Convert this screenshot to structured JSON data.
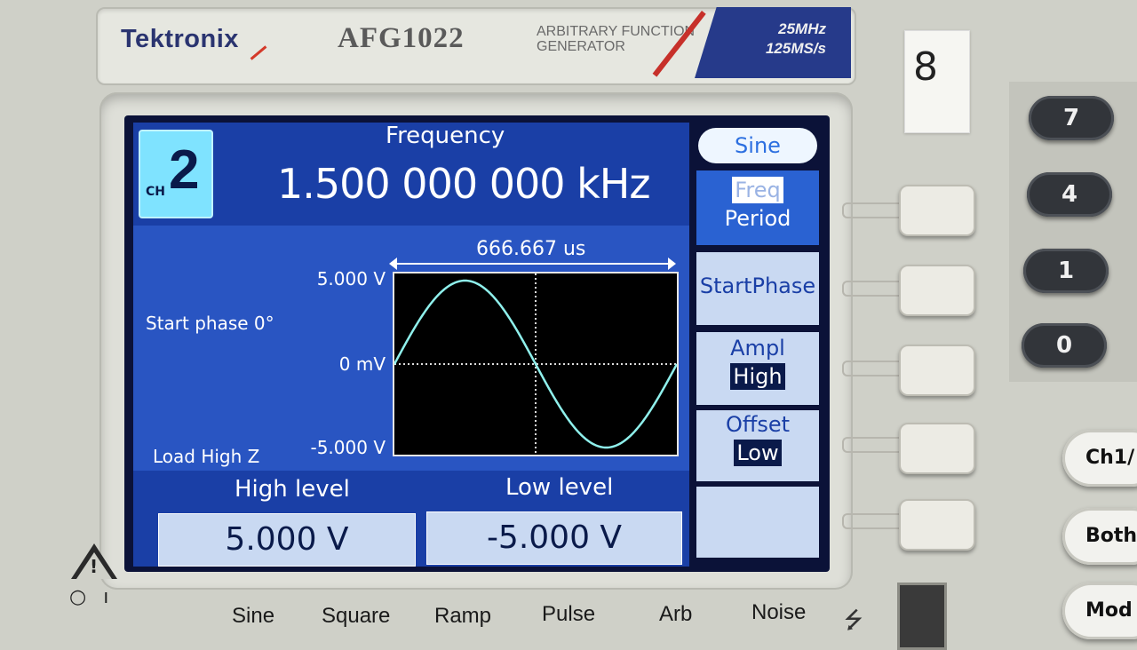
{
  "device": {
    "brand": "Tektronix",
    "model": "AFG1022",
    "subtitle_line1": "ARBITRARY FUNCTION",
    "subtitle_line2": "GENERATOR",
    "spec_line1": "25MHz",
    "spec_line2": "125MS/s",
    "sticker": "8"
  },
  "screen": {
    "channel_prefix": "CH",
    "channel_number": "2",
    "parameter_label": "Frequency",
    "parameter_value": "1.500 000 000 kHz",
    "period_label": "666.667 us",
    "y_top": "5.000 V",
    "y_mid": "0 mV",
    "y_bottom": "-5.000 V",
    "start_phase": "Start phase 0°",
    "load": "Load High Z",
    "high_level_label": "High level",
    "low_level_label": "Low level",
    "high_level_value": "5.000 V",
    "low_level_value": "-5.000 V",
    "waveform": {
      "shape": "sine",
      "cycles": 1,
      "start_phase_deg": 0,
      "trace_color": "#8ff0ec",
      "grid_color": "#dcdcdc"
    }
  },
  "menu": {
    "waveform_pill": "Sine",
    "item1_line1": "Freq",
    "item1_line2": "Period",
    "item2": "StartPhase",
    "item3_line1": "Ampl",
    "item3_line2": "High",
    "item4_line1": "Offset",
    "item4_line2": "Low"
  },
  "keypad": {
    "keys": [
      "7",
      "4",
      "1",
      "0"
    ],
    "ch_key": "Ch1/",
    "both_key": "Both",
    "mod_key": "Mod"
  },
  "function_keys": [
    "Sine",
    "Square",
    "Ramp",
    "Pulse",
    "Arb",
    "Noise"
  ],
  "colors": {
    "lcd_blue": "#2955c2",
    "lcd_dark_blue": "#1a3fa6",
    "channel_cyan": "#7fe3ff"
  }
}
